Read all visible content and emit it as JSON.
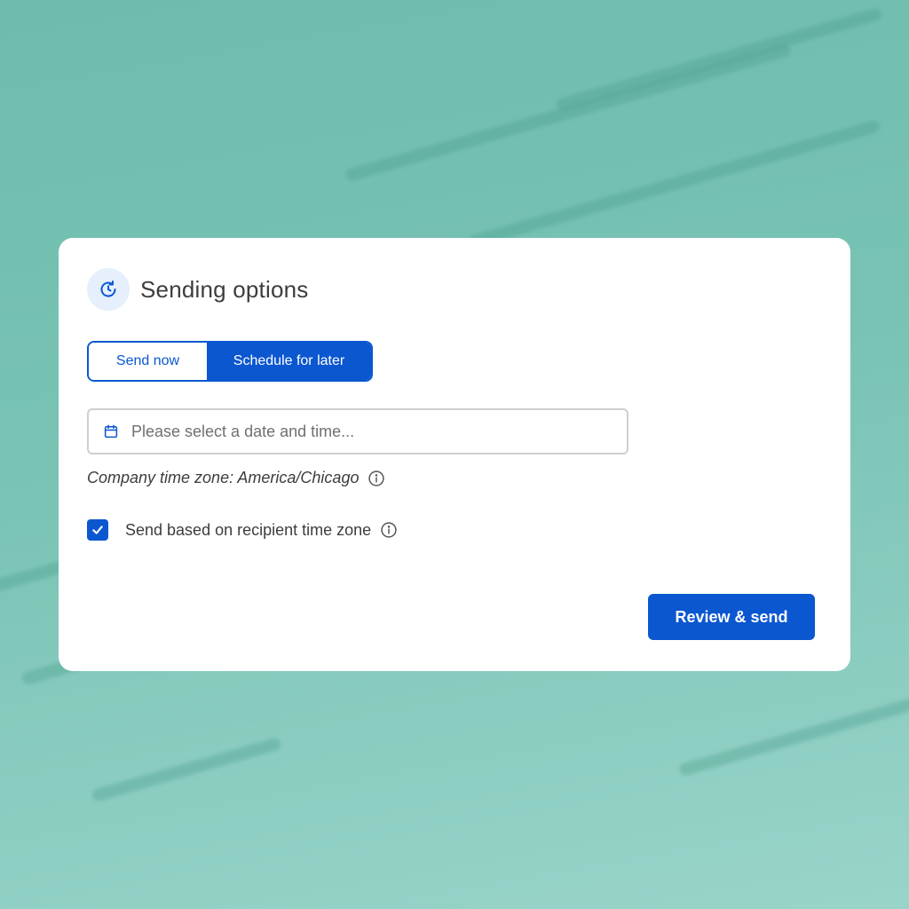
{
  "dialog": {
    "title": "Sending options",
    "header_icon": "clock-refresh-icon"
  },
  "send_mode": {
    "options": [
      "Send now",
      "Schedule for later"
    ],
    "selected": "Schedule for later"
  },
  "date_field": {
    "placeholder": "Please select a date and time...",
    "value": "",
    "icon": "calendar-icon"
  },
  "timezone": {
    "text": "Company time zone: America/Chicago",
    "info_icon": "info-icon"
  },
  "recipient_tz": {
    "label": "Send based on recipient time zone",
    "checked": true
  },
  "actions": {
    "primary_label": "Review & send"
  },
  "colors": {
    "accent": "#0b57d0",
    "background": "#78c3b4",
    "card": "#ffffff",
    "text": "#3d3d3d"
  }
}
